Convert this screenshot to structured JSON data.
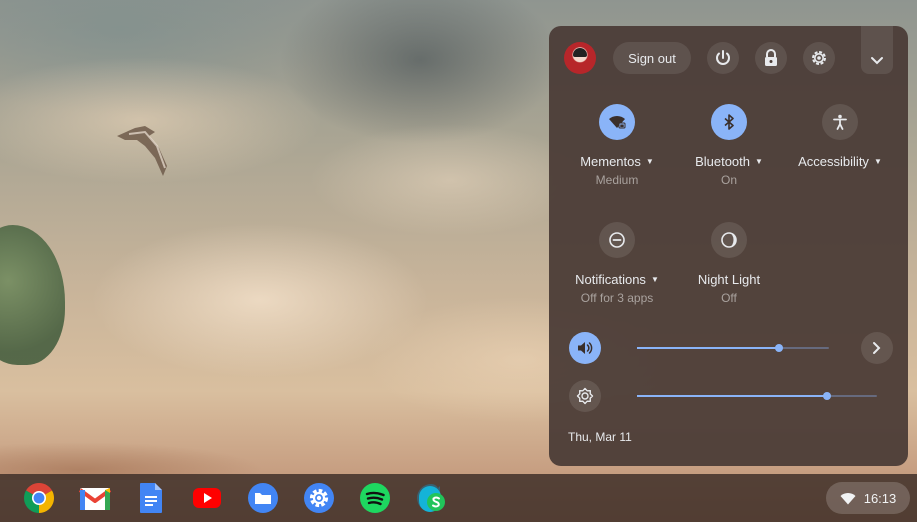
{
  "quick_settings": {
    "sign_out_label": "Sign out",
    "icons": {
      "power": "power-icon",
      "lock": "lock-icon",
      "settings": "gear-icon",
      "collapse": "chevron-down-icon"
    },
    "tiles": [
      {
        "label": "Mementos",
        "sub": "Medium",
        "icon": "wifi-locked-icon",
        "active": true,
        "has_menu": true
      },
      {
        "label": "Bluetooth",
        "sub": "On",
        "icon": "bluetooth-icon",
        "active": true,
        "has_menu": true
      },
      {
        "label": "Accessibility",
        "sub": "",
        "icon": "accessibility-icon",
        "active": false,
        "has_menu": true
      },
      {
        "label": "Notifications",
        "sub": "Off for 3 apps",
        "icon": "do-not-disturb-icon",
        "active": false,
        "has_menu": true
      },
      {
        "label": "Night Light",
        "sub": "Off",
        "icon": "night-light-icon",
        "active": false,
        "has_menu": false
      }
    ],
    "volume": {
      "level": 0.74,
      "icon": "volume-icon"
    },
    "brightness": {
      "level": 0.79,
      "icon": "brightness-icon"
    },
    "date": "Thu, Mar 11"
  },
  "shelf": {
    "apps": [
      "chrome-icon",
      "gmail-icon",
      "docs-icon",
      "youtube-icon",
      "files-icon",
      "settings-app-icon",
      "spotify-icon",
      "skype-icon"
    ],
    "tray": {
      "time": "16:13",
      "icon": "wifi-icon"
    }
  },
  "colors": {
    "accent": "#8ab4f8",
    "panel": "#4a3c36"
  }
}
